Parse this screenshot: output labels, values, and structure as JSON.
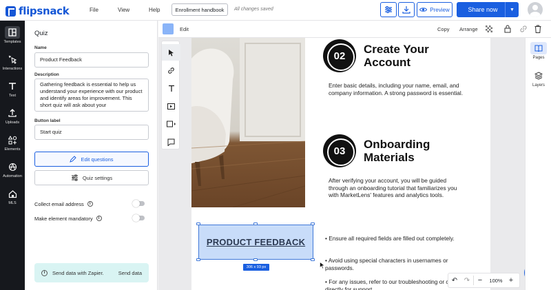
{
  "app": {
    "brand": "flipsnack",
    "brand_color": "#1557d6",
    "accent": "#1a5fe0"
  },
  "topbar": {
    "menu": [
      "File",
      "View",
      "Help"
    ],
    "doc_name": "Enrollment handbook",
    "save_status": "All changes saved",
    "preview_label": "Preview",
    "share_label": "Share now"
  },
  "rail": {
    "items": [
      {
        "label": "Templates",
        "icon": "layout-icon"
      },
      {
        "label": "Interactions",
        "icon": "cursor-click-icon"
      },
      {
        "label": "Text",
        "icon": "text-icon"
      },
      {
        "label": "Uploads",
        "icon": "upload-icon"
      },
      {
        "label": "Elements",
        "icon": "shapes-icon"
      },
      {
        "label": "Automation",
        "icon": "automation-icon"
      },
      {
        "label": "MLS",
        "icon": "house-icon"
      }
    ]
  },
  "panel": {
    "title": "Quiz",
    "name_label": "Name",
    "name_value": "Product Feedback",
    "description_label": "Description",
    "description_value": "Gathering feedback is essential to help us understand your experience with our product and identify areas for improvement. This short quiz will ask about your",
    "button_label_label": "Button label",
    "button_label_value": "Start quiz",
    "edit_questions": "Edit questions",
    "quiz_settings": "Quiz settings",
    "collect_email": "Collect email address",
    "mandatory": "Make element mandatory",
    "collect_email_on": false,
    "mandatory_on": false,
    "zapier_text": "Send data with Zapier.",
    "zapier_action": "Send data"
  },
  "editbar": {
    "edit": "Edit",
    "copy": "Copy",
    "arrange": "Arrange",
    "swatch_color": "#8ab4f8"
  },
  "page": {
    "step2": {
      "number": "02",
      "title_line1": "Create Your",
      "title_line2": "Account",
      "body": "Enter basic details, including your name, email, and company information. A strong password is essential."
    },
    "step3": {
      "number": "03",
      "title_line1": "Onboarding",
      "title_line2": "Materials",
      "body": "After verifying your account, you will be guided through an onboarding tutorial that familiarizes you with MarketLens' features and analytics tools."
    },
    "selected_text": "PRODUCT FEEDBACK",
    "size_tag": "306 x 93 px",
    "bullets": [
      "• Ensure all required fields are filled out completely.",
      "• Avoid using special characters in usernames or passwords.",
      "• For any issues, refer to our troubleshooting or contact us directly for support."
    ]
  },
  "zoom": {
    "value": "100%"
  },
  "right_rail": {
    "items": [
      {
        "label": "Pages",
        "icon": "book-icon"
      },
      {
        "label": "Layers",
        "icon": "layers-icon"
      }
    ]
  }
}
